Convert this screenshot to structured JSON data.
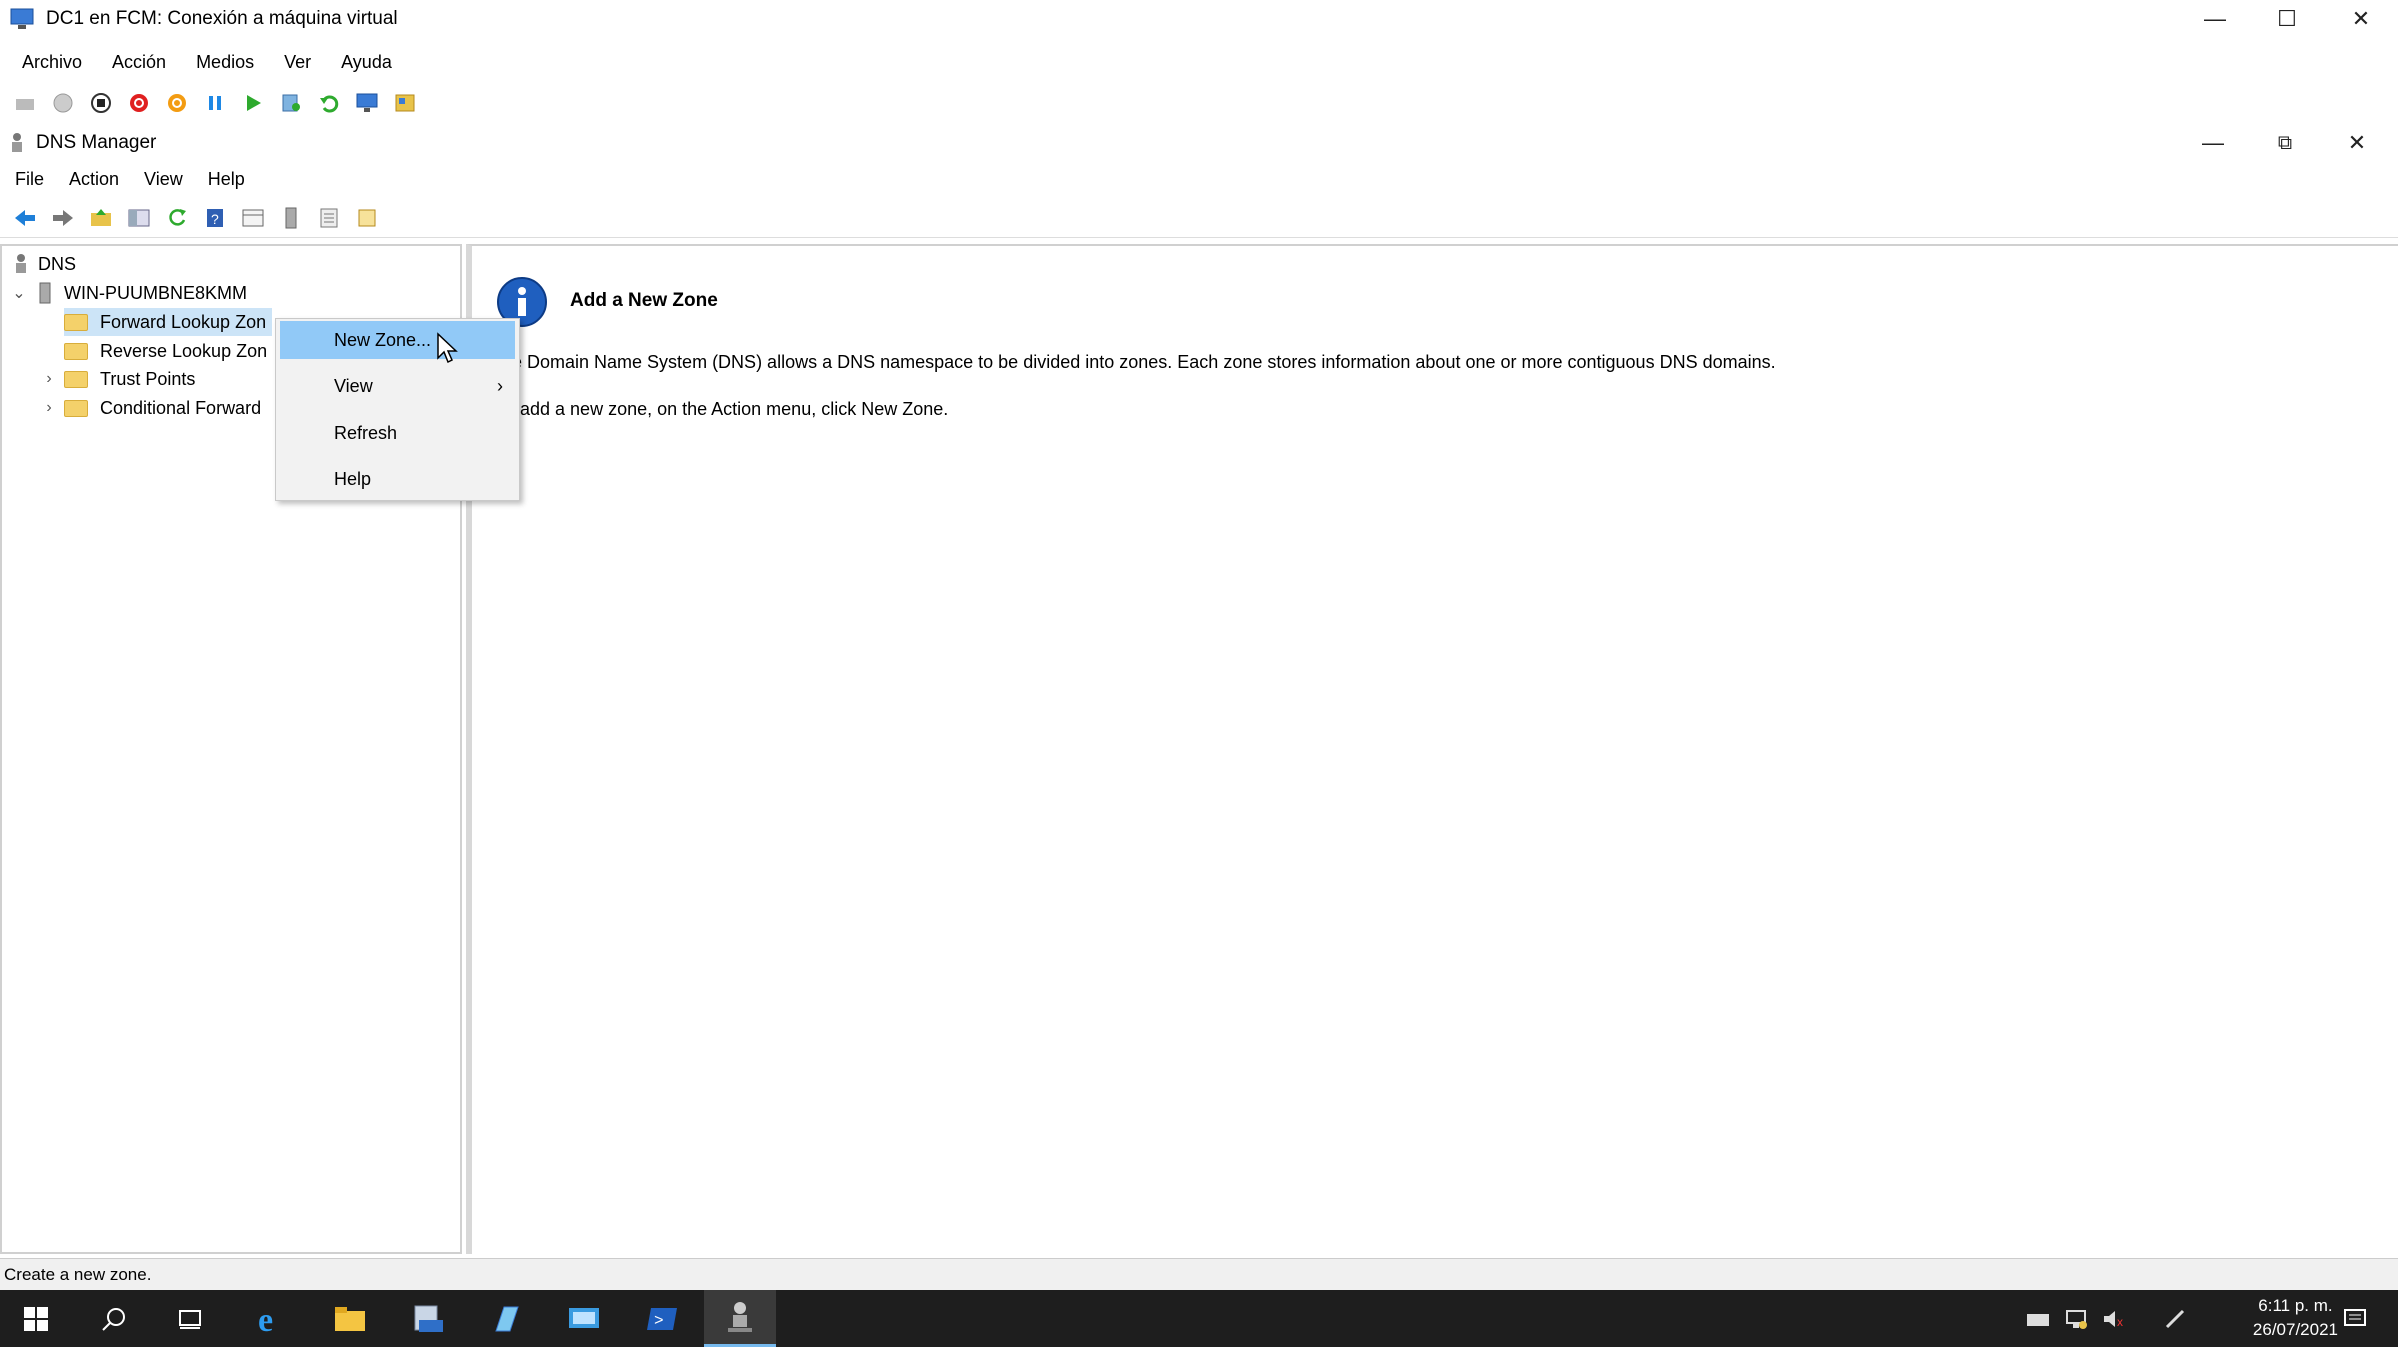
{
  "vm_window": {
    "title": "DC1 en FCM: Conexión a máquina virtual",
    "menu": [
      "Archivo",
      "Acción",
      "Medios",
      "Ver",
      "Ayuda"
    ]
  },
  "dns_window": {
    "title": "DNS Manager",
    "menu": [
      "File",
      "Action",
      "View",
      "Help"
    ]
  },
  "tree": {
    "root": "DNS",
    "server": "WIN-PUUMBNE8KMM",
    "items": [
      "Forward Lookup Zon",
      "Reverse Lookup Zon",
      "Trust Points",
      "Conditional Forward"
    ]
  },
  "context_menu": {
    "items": [
      "New Zone...",
      "View",
      "Refresh",
      "Help"
    ]
  },
  "info": {
    "heading": "Add a New Zone",
    "line1": "e Domain Name System (DNS) allows a DNS namespace to be divided into zones. Each zone stores information about one or more contiguous DNS domains.",
    "line2": "add a new zone, on the Action menu, click New Zone."
  },
  "status": "Create a new zone.",
  "clock": {
    "time": "6:11 p. m.",
    "date": "26/07/2021"
  },
  "colors": {
    "highlight": "#91c9f7",
    "taskbar": "#1e1e1e",
    "folder": "#f4d16a"
  }
}
